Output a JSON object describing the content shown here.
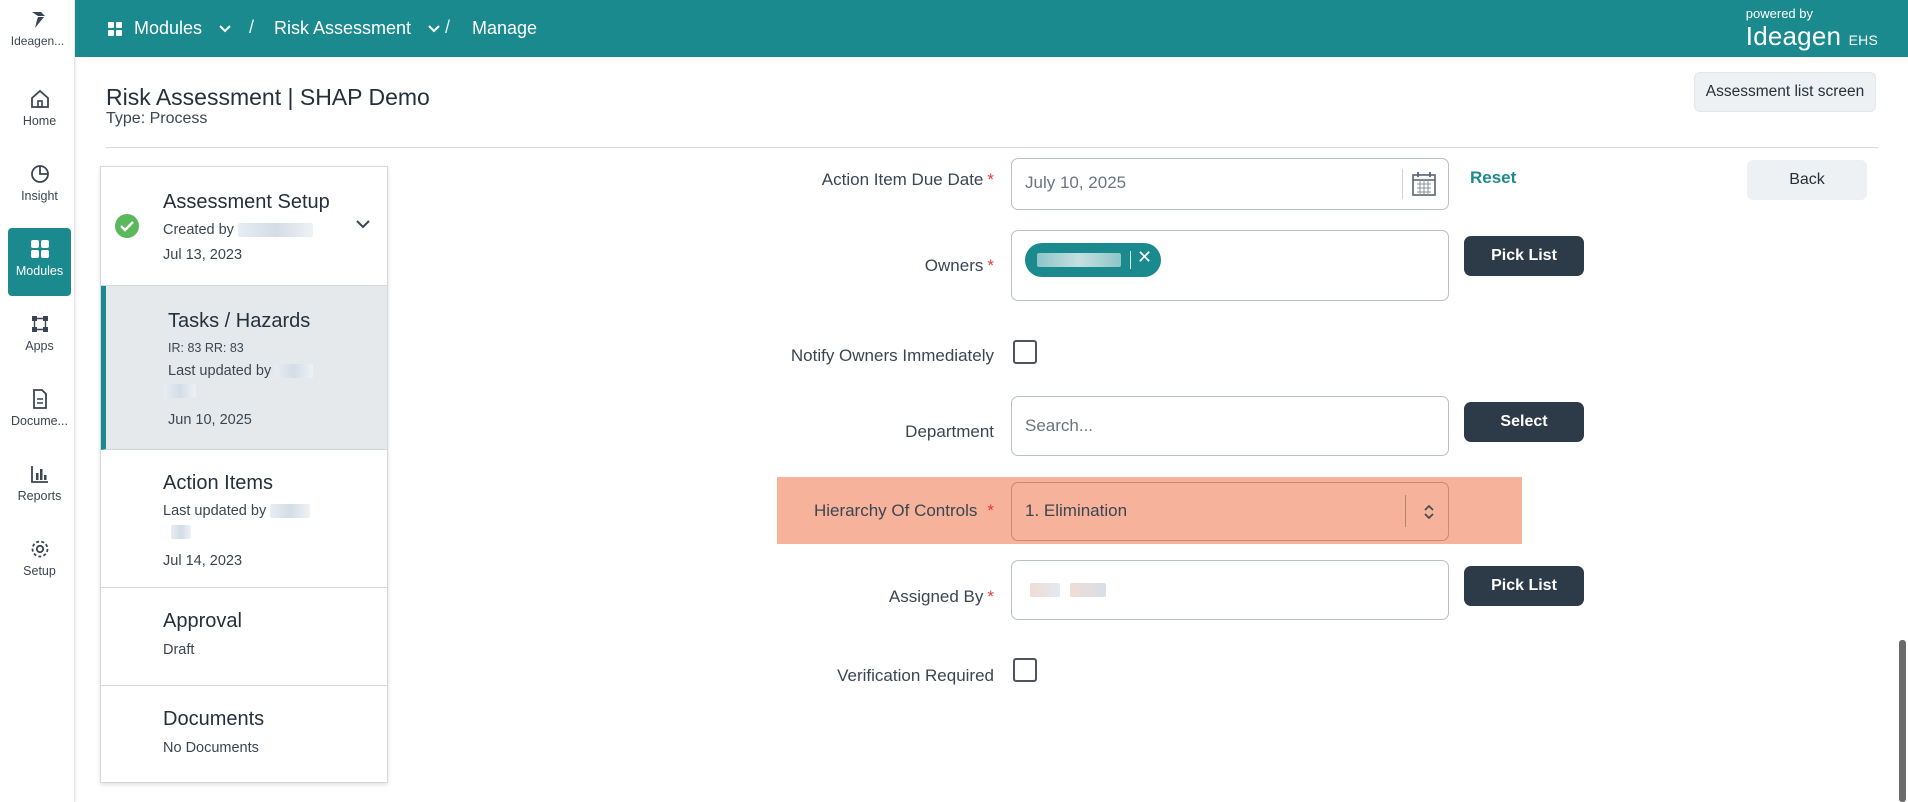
{
  "rail": {
    "logo_label": "Ideagen...",
    "items": [
      {
        "label": "Home",
        "icon": "home-icon"
      },
      {
        "label": "Insight",
        "icon": "pie-chart-icon"
      },
      {
        "label": "Modules",
        "icon": "grid-icon"
      },
      {
        "label": "Apps",
        "icon": "apps-icon"
      },
      {
        "label": "Docume...",
        "icon": "document-icon"
      },
      {
        "label": "Reports",
        "icon": "bar-chart-icon"
      },
      {
        "label": "Setup",
        "icon": "gear-icon"
      }
    ]
  },
  "topbar": {
    "crumbs": [
      "Modules",
      "Risk Assessment",
      "Manage"
    ],
    "separator": "/",
    "powered_by": "powered by",
    "brand": "Ideagen",
    "brand_suffix": "EHS"
  },
  "header": {
    "title": "Risk Assessment | SHAP Demo",
    "subtitle": "Type: Process",
    "list_button": "Assessment list screen"
  },
  "steps": [
    {
      "title": "Assessment Setup",
      "line1": "Created by",
      "date": "Jul 13, 2023"
    },
    {
      "title": "Tasks / Hazards",
      "line0": "IR: 83 RR: 83",
      "line1": "Last updated by",
      "date": "Jun 10, 2025"
    },
    {
      "title": "Action Items",
      "line1": "Last updated by",
      "date": "Jul 14, 2023"
    },
    {
      "title": "Approval",
      "line1": "Draft"
    },
    {
      "title": "Documents",
      "line1": "No Documents"
    }
  ],
  "form": {
    "due_date_label": "Action Item Due Date",
    "due_date_value": "July 10, 2025",
    "reset": "Reset",
    "back": "Back",
    "owners_label": "Owners",
    "pick_list": "Pick List",
    "notify_label": "Notify Owners Immediately",
    "department_label": "Department",
    "department_placeholder": "Search...",
    "select": "Select",
    "hierarchy_label": "Hierarchy Of Controls",
    "hierarchy_value": "1. Elimination",
    "assigned_label": "Assigned By",
    "verification_label": "Verification Required",
    "required_mark": "*"
  },
  "colors": {
    "accent": "#1a8a8e",
    "highlight": "#f7b29b",
    "dark_button": "#2d3a47"
  }
}
